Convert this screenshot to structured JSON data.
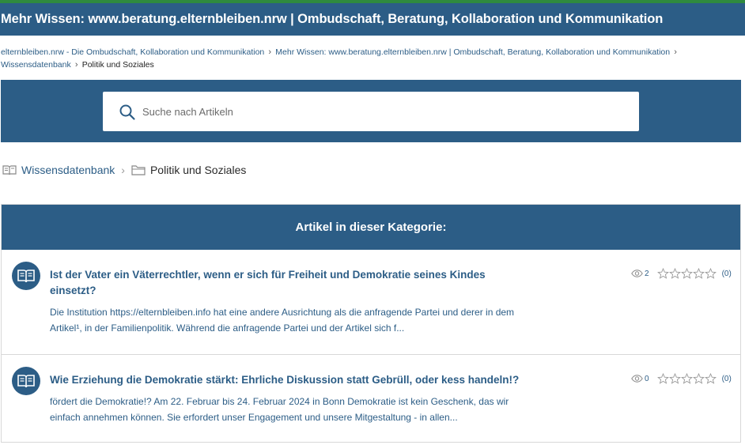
{
  "header": {
    "title": "Mehr Wissen: www.beratung.elternbleiben.nrw | Ombudschaft, Beratung, Kollaboration und Kommunikation"
  },
  "breadcrumb": {
    "items": [
      {
        "label": "elternbleiben.nrw - Die Ombudschaft, Kollaboration und Kommunikation"
      },
      {
        "label": "Mehr Wissen: www.beratung.elternbleiben.nrw | Ombudschaft, Beratung, Kollaboration und Kommunikation"
      },
      {
        "label": "Wissensdatenbank"
      },
      {
        "label": "Politik und Soziales"
      }
    ]
  },
  "search": {
    "placeholder": "Suche nach Artikeln",
    "icon": "search-icon"
  },
  "kb_path": {
    "root": "Wissensdatenbank",
    "category": "Politik und Soziales",
    "root_icon": "book-icon",
    "category_icon": "folder-icon"
  },
  "panel": {
    "heading": "Artikel in dieser Kategorie:"
  },
  "articles": [
    {
      "title": "Ist der Vater ein Väterrechtler, wenn er sich für Freiheit und Demokratie seines Kindes einsetzt?",
      "excerpt": "Die Institution https://elternbleiben.info hat eine andere Ausrichtung als die anfragende Partei und derer in dem Artikel¹, in der Familienpolitik. Während die anfragende Partei und der Artikel sich f...",
      "views": "2",
      "rating_count": "(0)",
      "rating": 0,
      "icon": "book-open-icon"
    },
    {
      "title": "Wie Erziehung die Demokratie stärkt: Ehrliche Diskussion statt Gebrüll, oder kess handeln!?",
      "excerpt": "fördert die Demokratie!? Am 22. Februar bis 24. Februar 2024 in Bonn  Demokratie ist kein Geschenk, das wir einfach annehmen können. Sie erfordert unser Engagement und unsere Mitgestaltung - in allen...",
      "views": "0",
      "rating_count": "(0)",
      "rating": 0,
      "icon": "book-open-icon"
    }
  ],
  "colors": {
    "brand": "#2c5d86",
    "accent_strip": "#2f8a3e"
  }
}
